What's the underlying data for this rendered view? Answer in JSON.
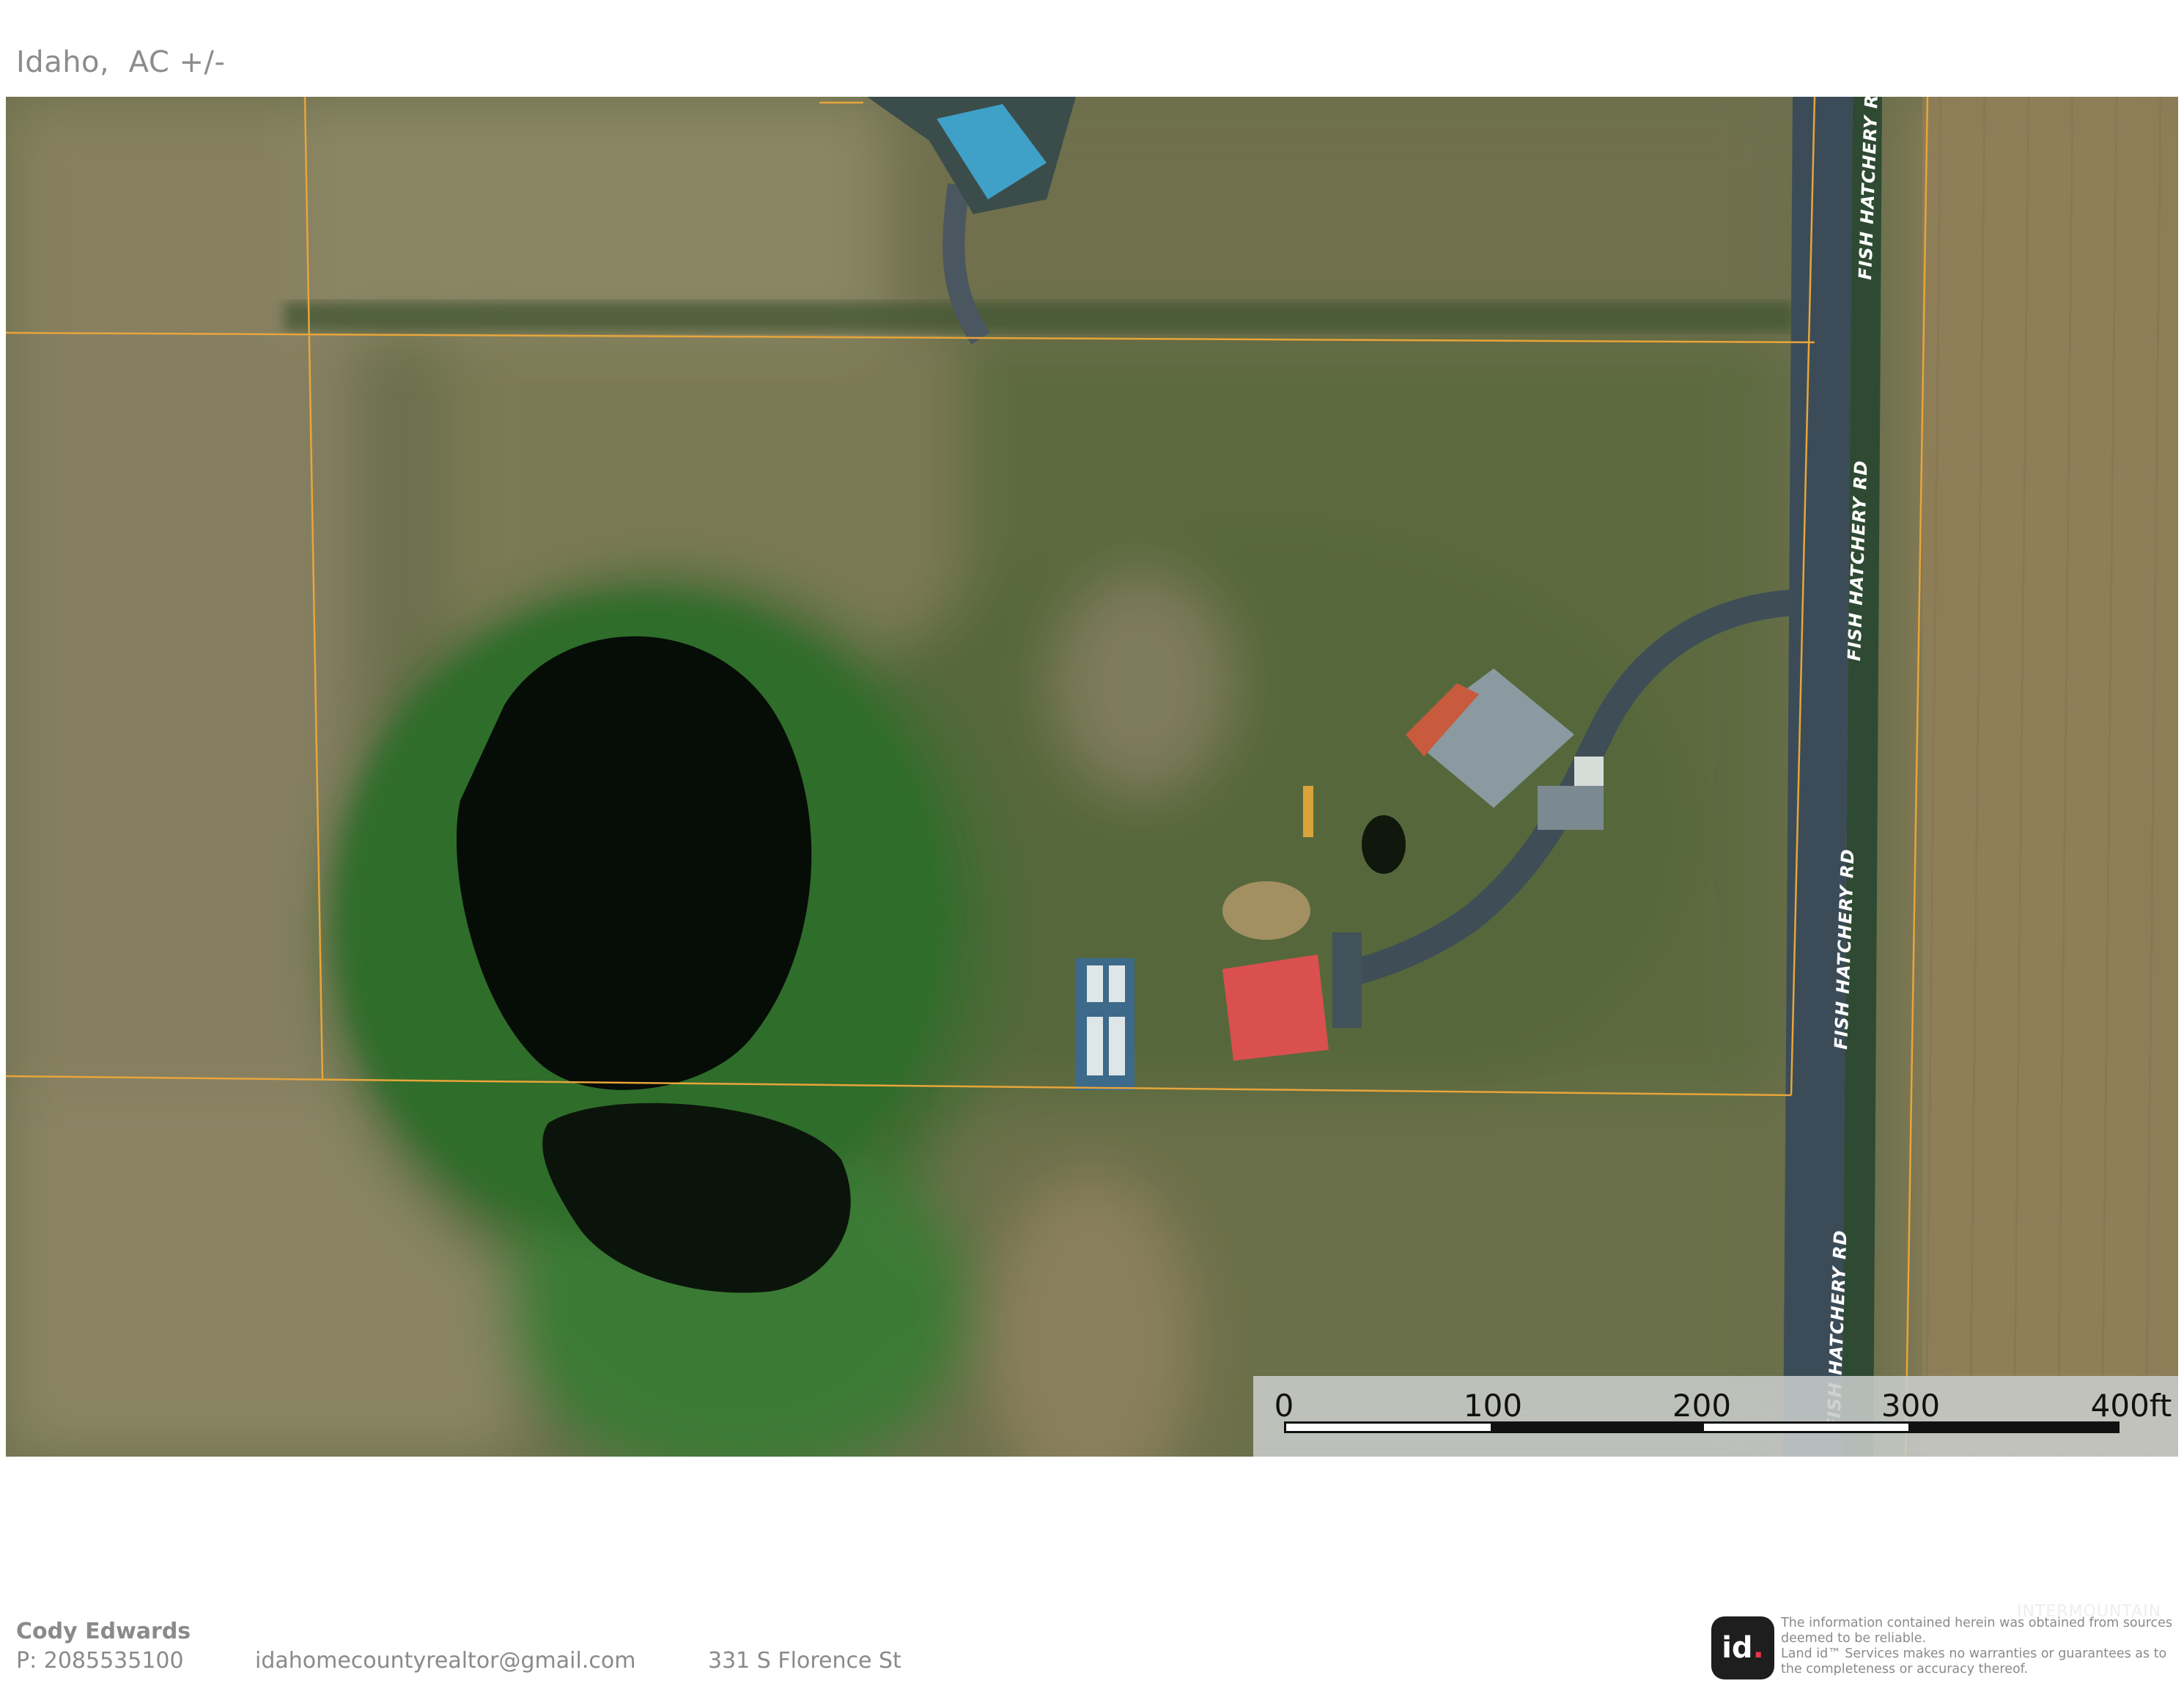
{
  "header": {
    "title": "Idaho,  AC +/-"
  },
  "map": {
    "road_label": "FISH HATCHERY RD",
    "colors": {
      "parcel_line": "#e8a53a",
      "road": "#3b4c58",
      "pond": "#050b05",
      "red_roof": "#d9504e",
      "blue_roof": "#3fa0c8"
    }
  },
  "scale_bar": {
    "labels": [
      "0",
      "100",
      "200",
      "300",
      "400ft"
    ],
    "unit": "ft"
  },
  "footer": {
    "agent_name": "Cody Edwards",
    "phone": "P: 2085535100",
    "email": "idahomecountyrealtor@gmail.com",
    "address": "331 S Florence St",
    "logo_text": "id",
    "logo_dot": ".",
    "disclaimer": "The information contained herein was obtained from sources deemed to be reliable.\n  Land id™ Services makes no warranties or guarantees as to the completeness or accuracy thereof.",
    "watermark": "INTERMOUNTAIN"
  }
}
